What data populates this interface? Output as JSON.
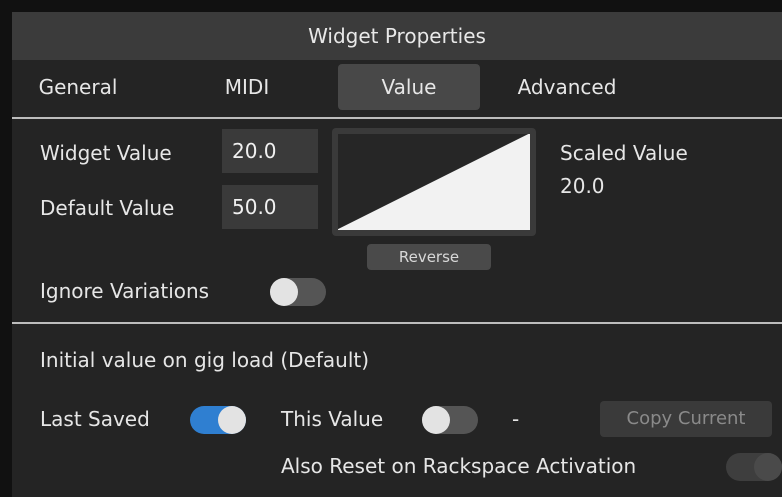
{
  "window": {
    "title": "Widget Properties"
  },
  "tabs": [
    {
      "label": "General"
    },
    {
      "label": "MIDI"
    },
    {
      "label": "Value",
      "active": true
    },
    {
      "label": "Advanced"
    }
  ],
  "value_tab": {
    "widget_value_label": "Widget Value",
    "widget_value": "20.0",
    "default_value_label": "Default Value",
    "default_value": "50.0",
    "reverse_button": "Reverse",
    "scaled_value_label": "Scaled Value",
    "scaled_value": "20.0",
    "ignore_variations_label": "Ignore Variations",
    "ignore_variations_on": false
  },
  "gig_load": {
    "heading": "Initial value on gig load (Default)",
    "last_saved_label": "Last Saved",
    "last_saved_on": true,
    "this_value_label": "This Value",
    "this_value_on": false,
    "this_value_display": "-",
    "copy_current_button": "Copy Current",
    "also_reset_label": "Also Reset on Rackspace Activation",
    "also_reset_on": false
  },
  "colors": {
    "accent": "#2f7fd1",
    "background": "#242424",
    "titlebar": "#3b3b3b"
  }
}
